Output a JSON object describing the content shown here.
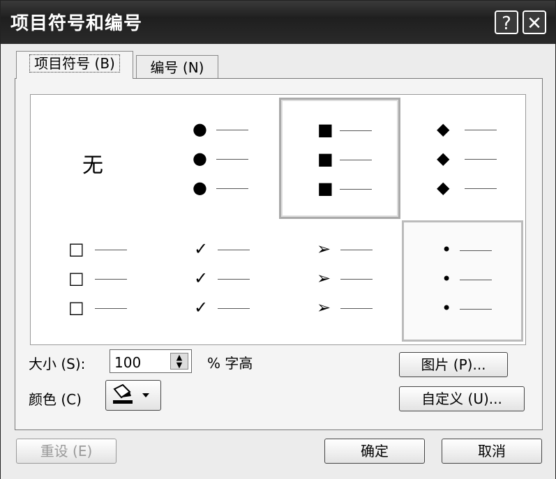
{
  "window": {
    "title": "项目符号和编号",
    "help_icon": "?",
    "close_icon": "✕"
  },
  "tabs": [
    {
      "label": "项目符号 (B)"
    },
    {
      "label": "编号 (N)"
    }
  ],
  "gallery": {
    "none_label": "无",
    "styles": [
      {
        "name": "none"
      },
      {
        "name": "filled-circle",
        "glyph": "●"
      },
      {
        "name": "filled-square",
        "glyph": "■"
      },
      {
        "name": "filled-diamond",
        "glyph": "◆"
      },
      {
        "name": "hollow-square",
        "glyph": "□"
      },
      {
        "name": "checkmark",
        "glyph": "✓"
      },
      {
        "name": "arrowhead",
        "glyph": "➢"
      },
      {
        "name": "small-dot",
        "glyph": "•"
      }
    ]
  },
  "size": {
    "label": "大小 (S):",
    "value": "100",
    "suffix": "% 字高"
  },
  "color": {
    "label": "颜色 (C)"
  },
  "buttons": {
    "picture": "图片 (P)...",
    "customize": "自定义 (U)...",
    "reset": "重设 (E)",
    "ok": "确定",
    "cancel": "取消"
  }
}
